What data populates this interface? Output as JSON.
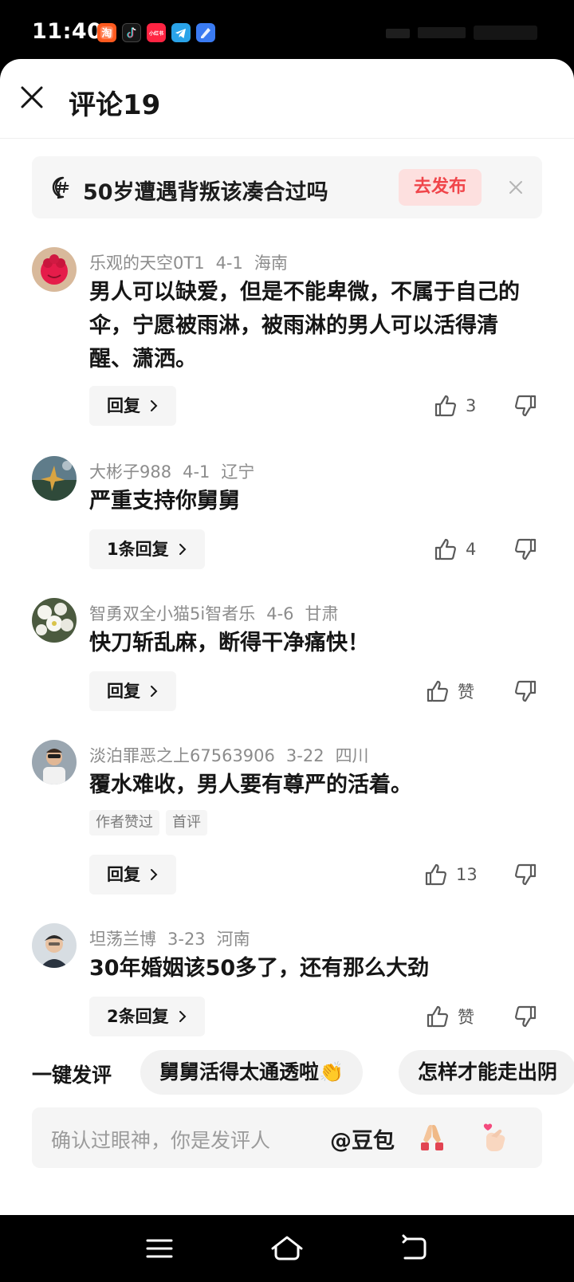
{
  "status_bar": {
    "time": "11:40",
    "app_icons": [
      "taobao-icon",
      "douyin-icon",
      "xiaohongshu-icon",
      "telegram-icon",
      "browser-icon"
    ],
    "xhs_text": "小红书"
  },
  "header": {
    "title": "评论19"
  },
  "topic": {
    "text": "50岁遭遇背叛该凑合过吗",
    "publish_label": "去发布"
  },
  "comments": [
    {
      "user": "乐观的天空0T1",
      "date": "4-1",
      "location": "海南",
      "text": "男人可以缺爱，但是不能卑微，不属于自己的伞，宁愿被雨淋，被雨淋的男人可以活得清醒、潇洒。",
      "reply_label": "回复",
      "likes": "3"
    },
    {
      "user": "大彬子988",
      "date": "4-1",
      "location": "辽宁",
      "text": "严重支持你舅舅",
      "reply_label": "1条回复",
      "likes": "4"
    },
    {
      "user": "智勇双全小猫5i智者乐",
      "date": "4-6",
      "location": "甘肃",
      "text": "快刀斩乱麻，断得干净痛快！",
      "reply_label": "回复",
      "likes": "赞"
    },
    {
      "user": "淡泊罪恶之上67563906",
      "date": "3-22",
      "location": "四川",
      "text": "覆水难收，男人要有尊严的活着。",
      "tags": [
        "作者赞过",
        "首评"
      ],
      "reply_label": "回复",
      "likes": "13"
    },
    {
      "user": "坦荡兰博",
      "date": "3-23",
      "location": "河南",
      "text": "30年婚姻该50多了，还有那么大劲",
      "reply_label": "2条回复",
      "likes": "赞"
    }
  ],
  "quick_comment": {
    "label": "一键发评",
    "chips": [
      "舅舅活得太通透啦👏",
      "怎样才能走出阴"
    ]
  },
  "input": {
    "placeholder": "确认过眼神，你是发评人",
    "mention": "@豆包",
    "emojis": [
      "folded-hands-icon",
      "finger-heart-icon"
    ]
  },
  "colors": {
    "accent_red": "#f0454a",
    "publish_bg": "#fde0df",
    "meta_gray": "#8c8c8c"
  }
}
